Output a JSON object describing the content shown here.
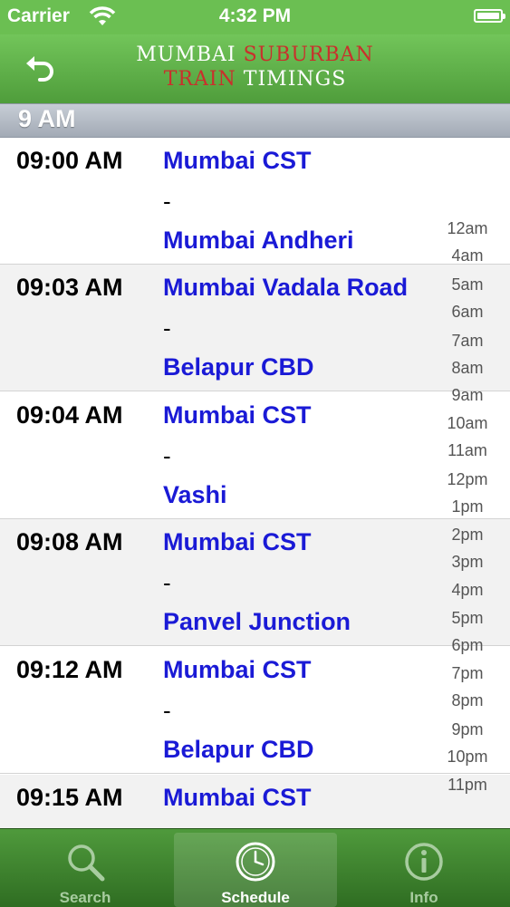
{
  "status_bar": {
    "carrier": "Carrier",
    "time": "4:32 PM"
  },
  "navbar": {
    "title_word1": "Mumbai",
    "title_word2": "Suburban",
    "title_word3": "Train",
    "title_word4": "Timings",
    "back_icon": "undo-arrow-icon"
  },
  "section": {
    "header": "9 AM"
  },
  "trains": [
    {
      "time": "09:00 AM",
      "from": "Mumbai CST",
      "separator": "-",
      "to": "Mumbai Andheri"
    },
    {
      "time": "09:03 AM",
      "from": "Mumbai Vadala Road",
      "separator": "-",
      "to": "Belapur CBD"
    },
    {
      "time": "09:04 AM",
      "from": "Mumbai CST",
      "separator": "-",
      "to": "Vashi"
    },
    {
      "time": "09:08 AM",
      "from": "Mumbai CST",
      "separator": "-",
      "to": "Panvel Junction"
    },
    {
      "time": "09:12 AM",
      "from": "Mumbai CST",
      "separator": "-",
      "to": "Belapur CBD"
    },
    {
      "time": "09:15 AM",
      "from": "Mumbai CST",
      "separator": "-",
      "to": ""
    }
  ],
  "index": [
    "12am",
    "4am",
    "5am",
    "6am",
    "7am",
    "8am",
    "9am",
    "10am",
    "11am",
    "12pm",
    "1pm",
    "2pm",
    "3pm",
    "4pm",
    "5pm",
    "6pm",
    "7pm",
    "8pm",
    "9pm",
    "10pm",
    "11pm"
  ],
  "tabs": [
    {
      "label": "Search",
      "icon": "search-icon"
    },
    {
      "label": "Schedule",
      "icon": "clock-icon",
      "active": true
    },
    {
      "label": "Info",
      "icon": "info-icon"
    }
  ],
  "colors": {
    "brand_green": "#6bbf52",
    "title_red": "#c9302c",
    "station_blue": "#1a1ad6"
  }
}
